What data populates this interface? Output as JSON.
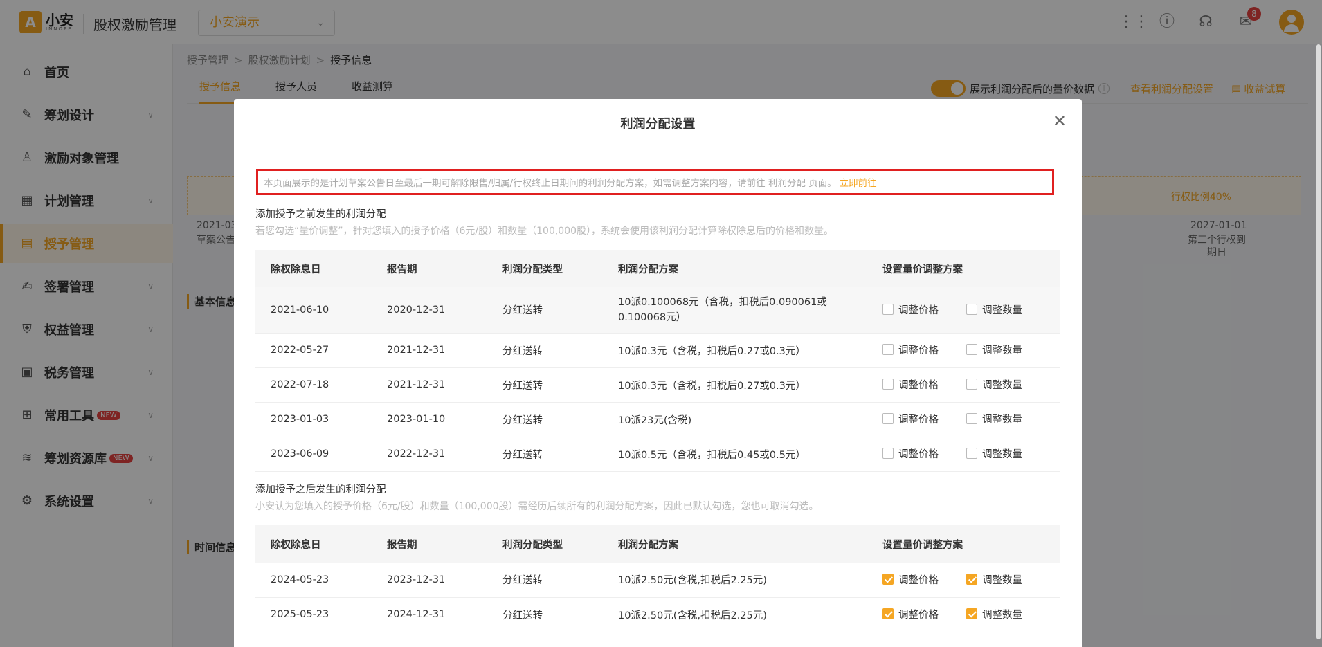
{
  "header": {
    "logo_mark": "A",
    "logo_cn": "小安",
    "logo_en": "INNOPE",
    "app_title": "股权激励管理",
    "company": "小安演示",
    "badge": "8"
  },
  "sidebar": {
    "items": [
      {
        "label": "首页",
        "icon": "home-icon"
      },
      {
        "label": "筹划设计",
        "icon": "edit-icon"
      },
      {
        "label": "激励对象管理",
        "icon": "users-icon"
      },
      {
        "label": "计划管理",
        "icon": "grid-icon"
      },
      {
        "label": "授予管理",
        "icon": "doc-icon"
      },
      {
        "label": "签署管理",
        "icon": "sign-icon"
      },
      {
        "label": "权益管理",
        "icon": "shield-icon"
      },
      {
        "label": "税务管理",
        "icon": "tax-icon"
      },
      {
        "label": "常用工具",
        "icon": "toolbox-icon",
        "tag": "NEW"
      },
      {
        "label": "筹划资源库",
        "icon": "layers-icon",
        "tag": "NEW"
      },
      {
        "label": "系统设置",
        "icon": "gear-icon"
      }
    ]
  },
  "breadcrumb": [
    "授予管理",
    "股权激励计划",
    "授予信息"
  ],
  "tabs": [
    "授予信息",
    "授予人员",
    "收益测算"
  ],
  "toolbar": {
    "toggle_label": "展示利润分配后的量价数据",
    "view_settings": "查看利润分配设置",
    "trial": "收益试算"
  },
  "background": {
    "band_text": "行权比例40%",
    "date_left": "2021-03",
    "date_left_sub": "草案公告",
    "date_right": "2027-01-01",
    "date_right_sub1": "第三个行权到",
    "date_right_sub2": "期日",
    "section_basic": "基本信息",
    "section_time": "时间信息"
  },
  "modal": {
    "title": "利润分配设置",
    "notice": "本页面展示的是计划草案公告日至最后一期可解除限售/归属/行权终止日期间的利润分配方案，如需调整方案内容，请前往 利润分配 页面。",
    "notice_link": "立即前往",
    "before_title": "添加授予之前发生的利润分配",
    "before_desc": "若您勾选“量价调整”，针对您填入的授予价格（6元/股）和数量（100,000股），系统会使用该利润分配计算除权除息后的价格和数量。",
    "after_title": "添加授予之后发生的利润分配",
    "after_desc": "小安认为您填入的授予价格（6元/股）和数量（100,000股）需经历后续所有的利润分配方案，因此已默认勾选，您也可取消勾选。",
    "columns": [
      "除权除息日",
      "报告期",
      "利润分配类型",
      "利润分配方案",
      "设置量价调整方案"
    ],
    "adjust_price": "调整价格",
    "adjust_qty": "调整数量",
    "before_rows": [
      {
        "date": "2021-06-10",
        "period": "2020-12-31",
        "type": "分红送转",
        "plan": "10派0.100068元（含税，扣税后0.090061或0.100068元）",
        "price": false,
        "qty": false
      },
      {
        "date": "2022-05-27",
        "period": "2021-12-31",
        "type": "分红送转",
        "plan": "10派0.3元（含税，扣税后0.27或0.3元）",
        "price": false,
        "qty": false
      },
      {
        "date": "2022-07-18",
        "period": "2021-12-31",
        "type": "分红送转",
        "plan": "10派0.3元（含税，扣税后0.27或0.3元）",
        "price": false,
        "qty": false
      },
      {
        "date": "2023-01-03",
        "period": "2023-01-10",
        "type": "分红送转",
        "plan": "10派23元(含税)",
        "price": false,
        "qty": false
      },
      {
        "date": "2023-06-09",
        "period": "2022-12-31",
        "type": "分红送转",
        "plan": "10派0.5元（含税，扣税后0.45或0.5元）",
        "price": false,
        "qty": false
      }
    ],
    "after_rows": [
      {
        "date": "2024-05-23",
        "period": "2023-12-31",
        "type": "分红送转",
        "plan": "10派2.50元(含税,扣税后2.25元)",
        "price": true,
        "qty": true
      },
      {
        "date": "2025-05-23",
        "period": "2024-12-31",
        "type": "分红送转",
        "plan": "10派2.50元(含税,扣税后2.25元)",
        "price": true,
        "qty": true
      }
    ]
  }
}
